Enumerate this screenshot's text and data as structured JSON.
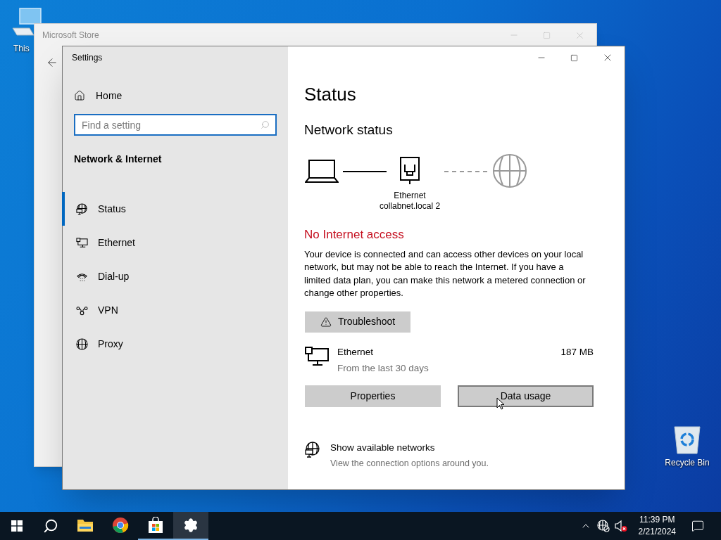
{
  "desktop_icons": [
    {
      "label": "This",
      "kind": "computer"
    },
    {
      "label": "Recycle Bin",
      "kind": "recycle"
    }
  ],
  "background_window": {
    "title": "Microsoft Store"
  },
  "settings": {
    "title": "Settings",
    "sidebar": {
      "home": "Home",
      "search": {
        "placeholder": "Find a setting"
      },
      "section": "Network & Internet",
      "items": [
        {
          "label": "Status",
          "kind": "status",
          "selected": true
        },
        {
          "label": "Ethernet",
          "kind": "ethernet",
          "selected": false
        },
        {
          "label": "Dial-up",
          "kind": "dialup",
          "selected": false
        },
        {
          "label": "VPN",
          "kind": "vpn",
          "selected": false
        },
        {
          "label": "Proxy",
          "kind": "proxy",
          "selected": false
        }
      ]
    },
    "page_title": "Status",
    "section_title": "Network status",
    "diagram": {
      "adapter_name": "Ethernet",
      "network_name": "collabnet.local 2",
      "internet_connected": false
    },
    "alert": "No Internet access",
    "description": "Your device is connected and can access other devices on your local network, but may not be able to reach the Internet. If you have a limited data plan, you can make this network a metered connection or change other properties.",
    "troubleshoot": "Troubleshoot",
    "usage": {
      "name": "Ethernet",
      "period": "From the last 30 days",
      "amount": "187 MB"
    },
    "buttons": [
      {
        "label": "Properties",
        "hovered": false
      },
      {
        "label": "Data usage",
        "hovered": true
      }
    ],
    "link": {
      "title": "Show available networks",
      "subtitle": "View the connection options around you."
    }
  },
  "taskbar": {
    "apps": [
      {
        "kind": "explorer",
        "running": false,
        "active": false
      },
      {
        "kind": "browser",
        "running": false,
        "active": false
      },
      {
        "kind": "store",
        "running": true,
        "active": false
      },
      {
        "kind": "settings",
        "running": true,
        "active": true
      }
    ],
    "time": "11:39 PM",
    "date": "2/21/2024"
  }
}
